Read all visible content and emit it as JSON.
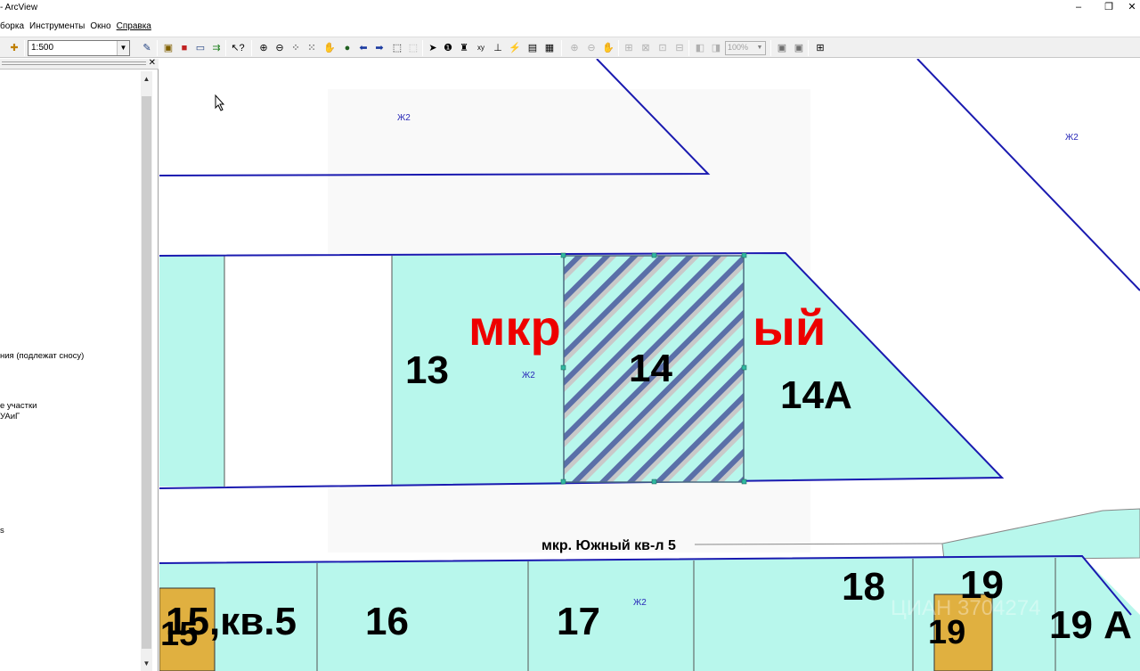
{
  "window": {
    "title": "- ArcView",
    "minimize": "–",
    "restore": "❐",
    "close": "✕"
  },
  "menu": [
    "борка",
    "Инструменты",
    "Окно",
    "Справка"
  ],
  "toolbar": {
    "scale_value": "1:500",
    "zoom_value": "100%"
  },
  "toc": {
    "lines": [
      "ния (подлежат сносу)",
      "е участки",
      "УАиГ",
      "s"
    ]
  },
  "map": {
    "zone_labels": [
      "Ж2",
      "Ж2",
      "Ж2",
      "Ж2"
    ],
    "plots": [
      "13",
      "14",
      "14А",
      "15,кв.5",
      "15",
      "16",
      "17",
      "18",
      "19",
      "19",
      "19 А"
    ],
    "district_text_left": "мкр",
    "district_text_right": "ый",
    "street_label": "мкр. Южный кв-л 5",
    "watermark": "ЦИАН 3704274"
  },
  "colors": {
    "plot_fill": "#b8f7ec",
    "boundary": "#1a1ab0",
    "building": "#e0b040",
    "hatch": "#5a6fa8",
    "red_label": "#ee0000"
  }
}
